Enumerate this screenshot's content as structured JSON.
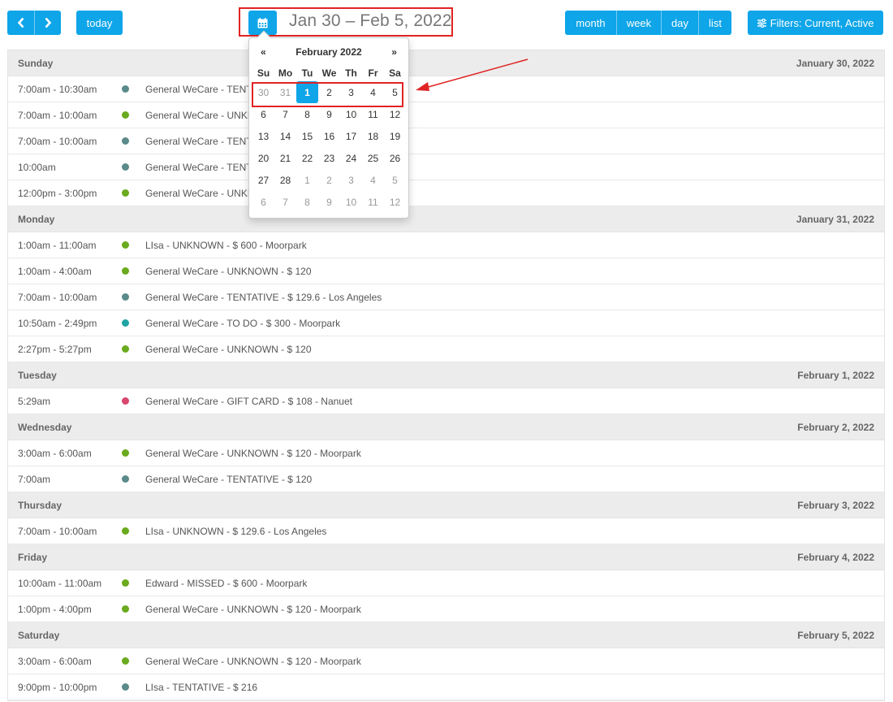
{
  "toolbar": {
    "prev_icon": "chevron-left-icon",
    "next_icon": "chevron-right-icon",
    "today_label": "today",
    "calendar_icon": "calendar-icon",
    "range_title": "Jan 30 – Feb 5, 2022",
    "views": [
      "month",
      "week",
      "day",
      "list"
    ],
    "filters_icon": "sliders-icon",
    "filters_label": "Filters: Current, Active",
    "accent": "#0ea5e9"
  },
  "datepicker": {
    "prev_label": "«",
    "next_label": "»",
    "month_label": "February 2022",
    "dow": [
      "Su",
      "Mo",
      "Tu",
      "We",
      "Th",
      "Fr",
      "Sa"
    ],
    "weeks": [
      [
        "30",
        "31",
        "1",
        "2",
        "3",
        "4",
        "5"
      ],
      [
        "6",
        "7",
        "8",
        "9",
        "10",
        "11",
        "12"
      ],
      [
        "13",
        "14",
        "15",
        "16",
        "17",
        "18",
        "19"
      ],
      [
        "20",
        "21",
        "22",
        "23",
        "24",
        "25",
        "26"
      ],
      [
        "27",
        "28",
        "1",
        "2",
        "3",
        "4",
        "5"
      ],
      [
        "6",
        "7",
        "8",
        "9",
        "10",
        "11",
        "12"
      ]
    ],
    "selected": "1"
  },
  "status_colors": {
    "tentative": "#5b8a8a",
    "unknown": "#6aaa1e",
    "todo": "#20a3a3",
    "giftcard": "#d9466e",
    "missed": "#6aaa1e"
  },
  "days": [
    {
      "name": "Sunday",
      "date": "January 30, 2022",
      "events": [
        {
          "time": "7:00am - 10:30am",
          "title": "General WeCare - TENTATIVE",
          "color": "#5b8a8a"
        },
        {
          "time": "7:00am - 10:00am",
          "title": "General WeCare - UNKNOWN",
          "color": "#6aaa1e"
        },
        {
          "time": "7:00am - 10:00am",
          "title": "General WeCare - TENTATIVE",
          "color": "#5b8a8a"
        },
        {
          "time": "10:00am",
          "title": "General WeCare - TENTATIVE",
          "color": "#5b8a8a"
        },
        {
          "time": "12:00pm - 3:00pm",
          "title": "General WeCare - UNKNOWN",
          "color": "#6aaa1e"
        }
      ]
    },
    {
      "name": "Monday",
      "date": "January 31, 2022",
      "events": [
        {
          "time": "1:00am - 11:00am",
          "title": "LIsa - UNKNOWN - $ 600 - Moorpark",
          "color": "#6aaa1e"
        },
        {
          "time": "1:00am - 4:00am",
          "title": "General WeCare - UNKNOWN - $ 120",
          "color": "#6aaa1e"
        },
        {
          "time": "7:00am - 10:00am",
          "title": "General WeCare - TENTATIVE - $ 129.6 - Los Angeles",
          "color": "#5b8a8a"
        },
        {
          "time": "10:50am - 2:49pm",
          "title": "General WeCare - TO DO - $ 300 - Moorpark",
          "color": "#20a3a3"
        },
        {
          "time": "2:27pm - 5:27pm",
          "title": "General WeCare - UNKNOWN - $ 120",
          "color": "#6aaa1e"
        }
      ]
    },
    {
      "name": "Tuesday",
      "date": "February 1, 2022",
      "events": [
        {
          "time": "5:29am",
          "title": "General WeCare - GIFT CARD - $ 108 - Nanuet",
          "color": "#d9466e"
        }
      ]
    },
    {
      "name": "Wednesday",
      "date": "February 2, 2022",
      "events": [
        {
          "time": "3:00am - 6:00am",
          "title": "General WeCare - UNKNOWN - $ 120 - Moorpark",
          "color": "#6aaa1e"
        },
        {
          "time": "7:00am",
          "title": "General WeCare - TENTATIVE - $ 120",
          "color": "#5b8a8a"
        }
      ]
    },
    {
      "name": "Thursday",
      "date": "February 3, 2022",
      "events": [
        {
          "time": "7:00am - 10:00am",
          "title": "LIsa - UNKNOWN - $ 129.6 - Los Angeles",
          "color": "#6aaa1e"
        }
      ]
    },
    {
      "name": "Friday",
      "date": "February 4, 2022",
      "events": [
        {
          "time": "10:00am - 11:00am",
          "title": "Edward - MISSED - $ 600 - Moorpark",
          "color": "#6aaa1e"
        },
        {
          "time": "1:00pm - 4:00pm",
          "title": "General WeCare - UNKNOWN - $ 120 - Moorpark",
          "color": "#6aaa1e"
        }
      ]
    },
    {
      "name": "Saturday",
      "date": "February 5, 2022",
      "events": [
        {
          "time": "3:00am - 6:00am",
          "title": "General WeCare - UNKNOWN - $ 120 - Moorpark",
          "color": "#6aaa1e"
        },
        {
          "time": "9:00pm - 10:00pm",
          "title": "LIsa - TENTATIVE - $ 216",
          "color": "#5b8a8a"
        }
      ]
    }
  ]
}
